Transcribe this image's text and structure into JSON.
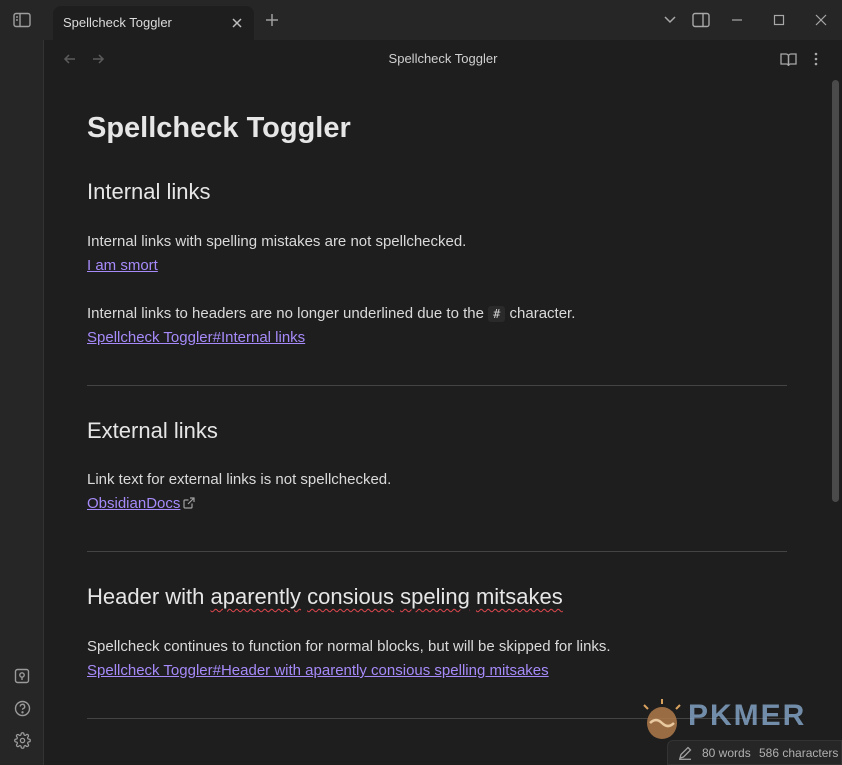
{
  "tab": {
    "title": "Spellcheck Toggler"
  },
  "view": {
    "title": "Spellcheck Toggler"
  },
  "note": {
    "title": "Spellcheck Toggler",
    "sections": [
      {
        "heading": "Internal links",
        "para1": "Internal links with spelling mistakes are not spellchecked.",
        "link1": "I am smort",
        "para2_before": "Internal links to headers are no longer underlined due to the",
        "para2_code": "#",
        "para2_after": "character.",
        "link2": "Spellcheck Toggler#Internal links"
      },
      {
        "heading": "External links",
        "para": "Link text for external links is not spellchecked.",
        "link": "ObsidianDocs"
      },
      {
        "heading_w1": "Header with",
        "heading_w2": "aparently",
        "heading_w3": "consious",
        "heading_w4": "speling",
        "heading_w5": "mitsakes",
        "para": "Spellcheck continues to function for normal blocks, but will be skipped for links.",
        "link": "Spellcheck Toggler#Header with aparently consious spelling mitsakes"
      }
    ]
  },
  "status": {
    "words": "80 words",
    "characters": "586 characters"
  },
  "watermark": {
    "text": "PKMER"
  },
  "icons": [
    "sidebar-toggle-icon",
    "close-icon",
    "plus-icon",
    "chevron-down-icon",
    "layout-icon",
    "minimize-icon",
    "maximize-icon",
    "window-close-icon",
    "arrow-left-icon",
    "arrow-right-icon",
    "book-open-icon",
    "more-vertical-icon",
    "vault-switcher-icon",
    "help-icon",
    "settings-icon",
    "external-link-icon",
    "pencil-icon"
  ],
  "colors": {
    "link": "#a68af9",
    "misspelling": "#e0484f",
    "background": "#1e1e1e"
  }
}
